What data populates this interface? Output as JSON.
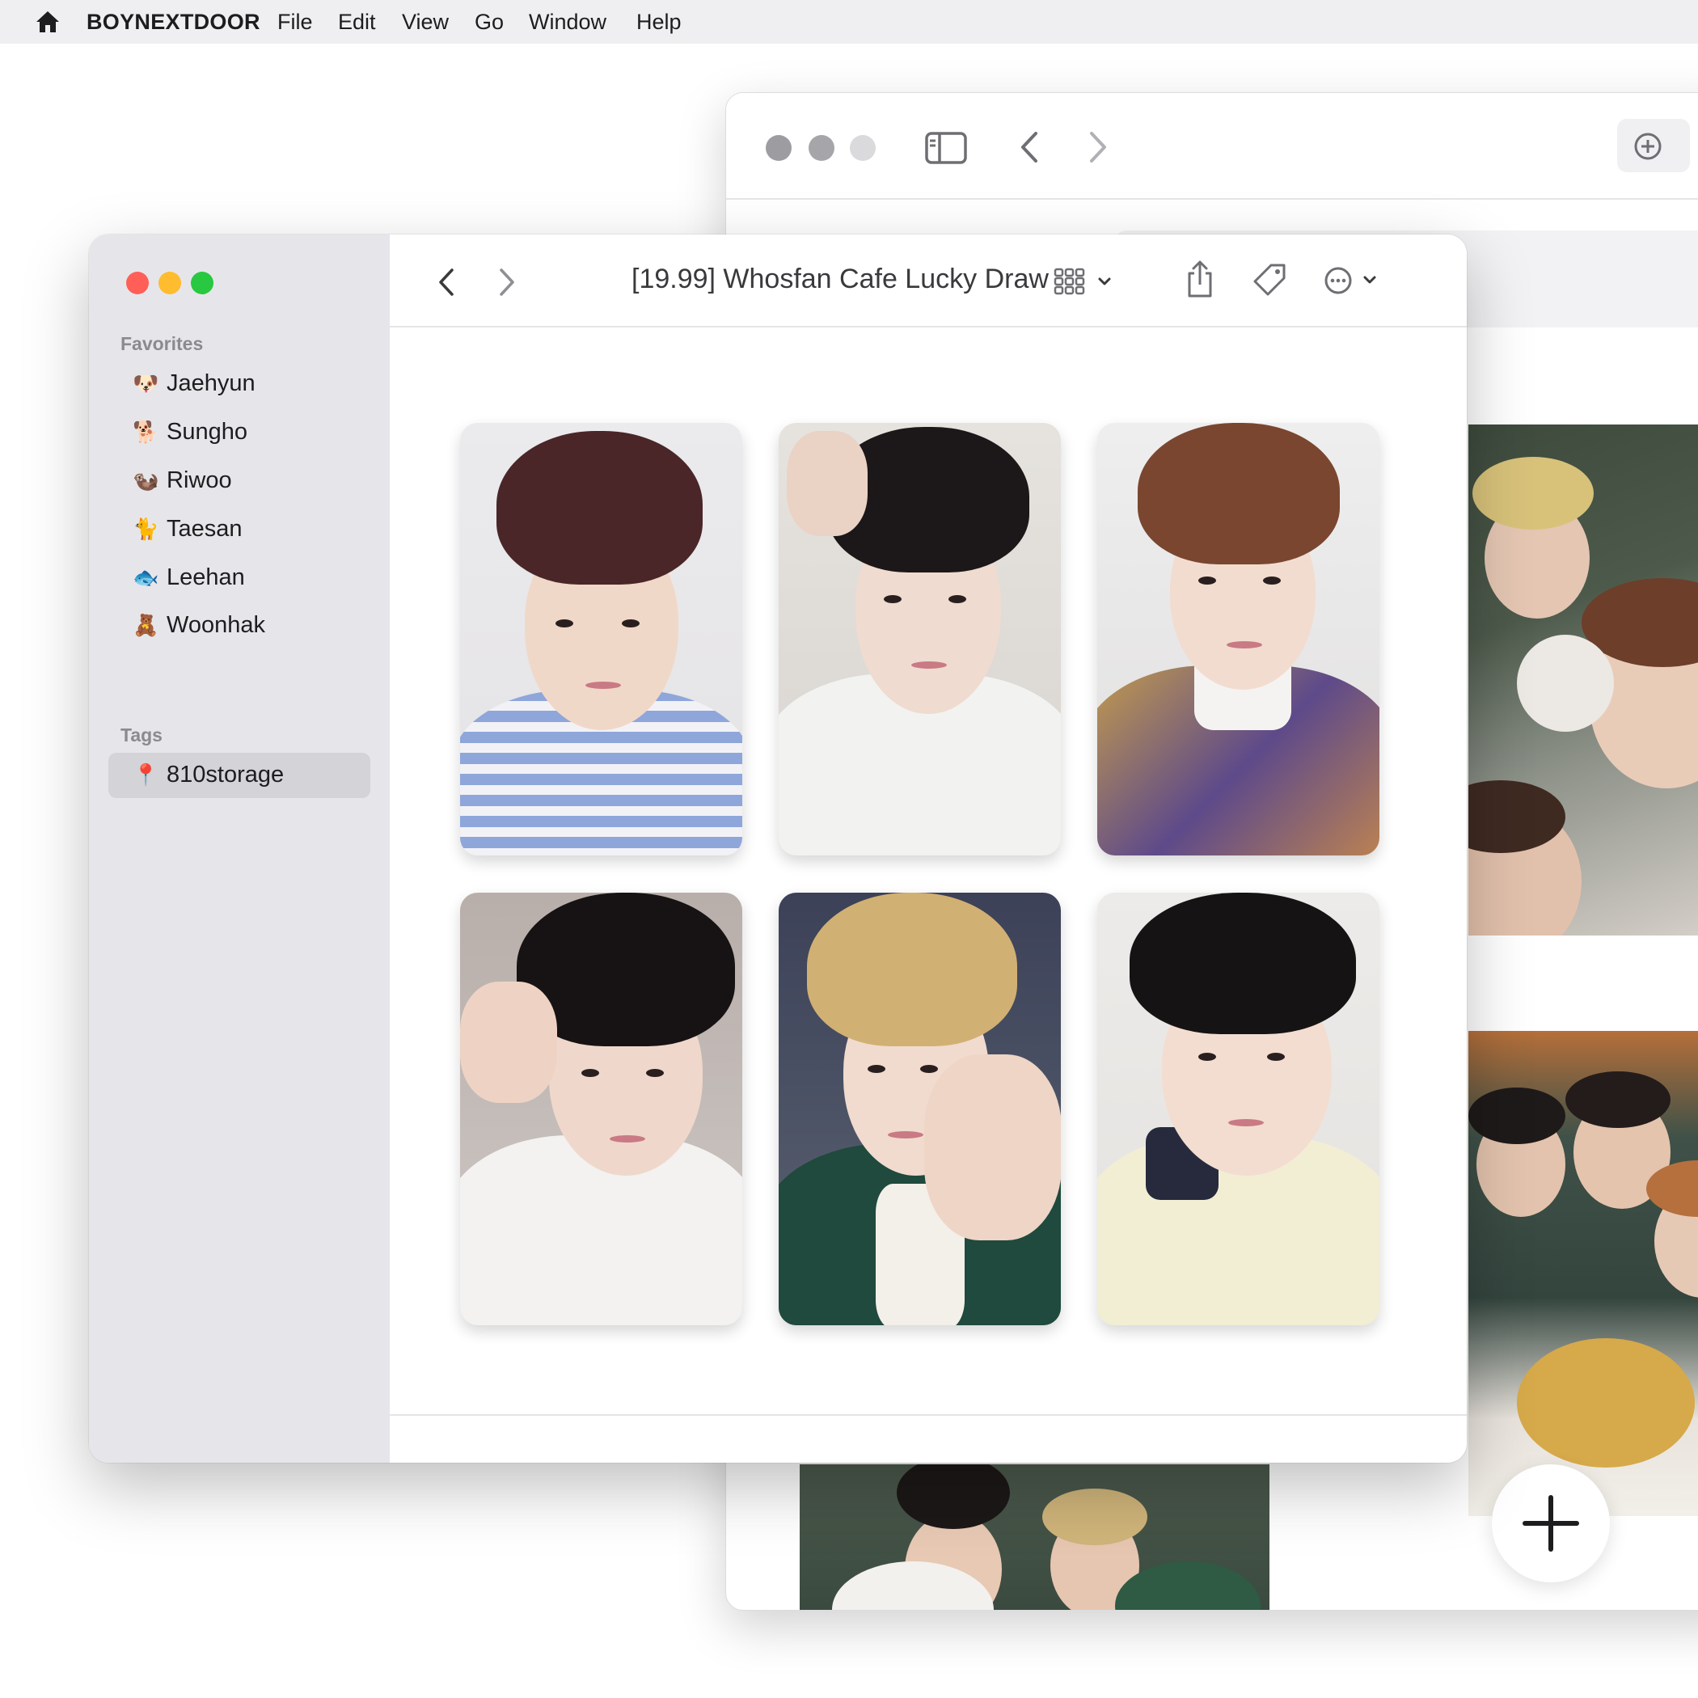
{
  "menubar": {
    "app_name": "BOYNEXTDOOR",
    "items": [
      "File",
      "Edit",
      "View",
      "Go",
      "Window",
      "Help"
    ]
  },
  "finder": {
    "title": "[19.99] Whosfan Cafe Lucky Draw",
    "sidebar": {
      "favorites_title": "Favorites",
      "favorites": [
        {
          "emoji": "🐶",
          "label": "Jaehyun"
        },
        {
          "emoji": "🐕",
          "label": "Sungho"
        },
        {
          "emoji": "🦦",
          "label": "Riwoo"
        },
        {
          "emoji": "🐈",
          "label": "Taesan"
        },
        {
          "emoji": "🐟",
          "label": "Leehan"
        },
        {
          "emoji": "🧸",
          "label": "Woonhak"
        }
      ],
      "tags_title": "Tags",
      "tags": [
        {
          "emoji": "📍",
          "label": "810storage",
          "selected": true
        }
      ]
    }
  },
  "colors": {
    "close": "#ff5f57",
    "minimize": "#febc2e",
    "zoom": "#28c840"
  }
}
